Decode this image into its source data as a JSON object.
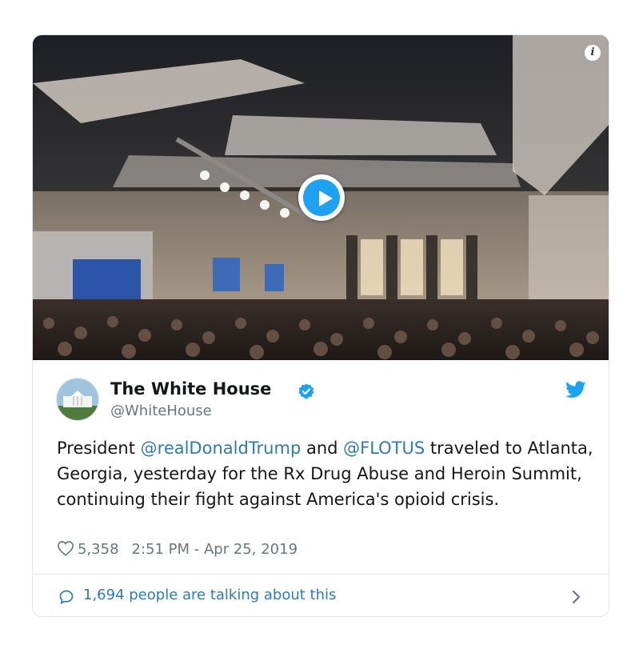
{
  "media": {
    "icons": {
      "info": "info-icon",
      "play": "play-icon"
    }
  },
  "author": {
    "name": "The White House",
    "handle": "@WhiteHouse",
    "verified": true,
    "avatar_icon": "white-house-avatar"
  },
  "tweet": {
    "segments": [
      {
        "text": "President ",
        "mention": false
      },
      {
        "text": "@realDonaldTrump",
        "mention": true
      },
      {
        "text": " and ",
        "mention": false
      },
      {
        "text": "@FLOTUS",
        "mention": true
      },
      {
        "text": " traveled to Atlanta, Georgia, yesterday for the Rx Drug Abuse and Heroin Summit, continuing their fight against America's opioid crisis.",
        "mention": false
      }
    ]
  },
  "meta": {
    "likes": "5,358",
    "timestamp": "2:51 PM - Apr 25, 2019"
  },
  "footer": {
    "talking": "1,694 people are talking about this"
  },
  "colors": {
    "accent": "#1da1f2",
    "link": "#2b7bb9",
    "muted": "#657786",
    "border": "#e1e8ed"
  }
}
